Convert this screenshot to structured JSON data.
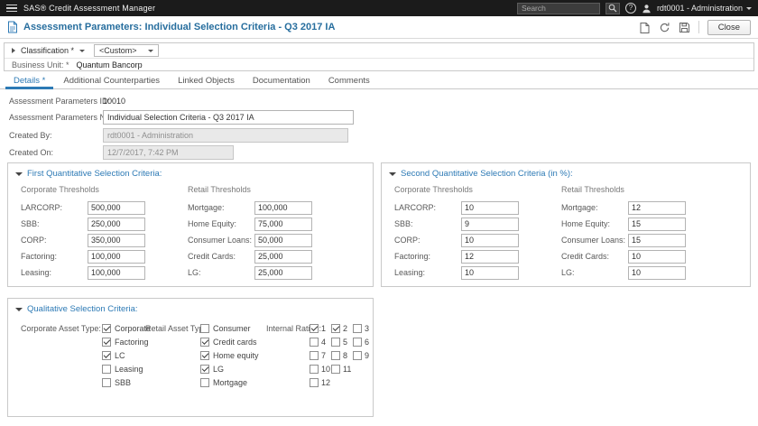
{
  "topbar": {
    "app_title": "SAS® Credit Assessment Manager",
    "search_placeholder": "Search",
    "user_label": "rdt0001 - Administration"
  },
  "header": {
    "title": "Assessment Parameters: Individual Selection Criteria - Q3 2017 IA",
    "close_label": "Close"
  },
  "toolbar": {
    "classification_label": "Classification *",
    "classification_value": "<Custom>",
    "business_unit_label": "Business Unit: *",
    "business_unit_value": "Quantum Bancorp"
  },
  "tabs": [
    {
      "label": "Details *"
    },
    {
      "label": "Additional Counterparties"
    },
    {
      "label": "Linked Objects"
    },
    {
      "label": "Documentation"
    },
    {
      "label": "Comments"
    }
  ],
  "form": {
    "rows": [
      {
        "label": "Assessment Parameters ID:",
        "value": "10010"
      },
      {
        "label": "Assessment Parameters Name: *",
        "value": "Individual Selection Criteria - Q3 2017 IA"
      },
      {
        "label": "Created By:",
        "value": "rdt0001 - Administration"
      },
      {
        "label": "Created On:",
        "value": "12/7/2017, 7:42 PM"
      }
    ]
  },
  "first_criteria": {
    "title": "First Quantitative Selection Criteria:",
    "corporate_header": "Corporate Thresholds",
    "retail_header": "Retail Thresholds",
    "corporate": [
      {
        "label": "LARCORP:",
        "value": "500,000"
      },
      {
        "label": "SBB:",
        "value": "250,000"
      },
      {
        "label": "CORP:",
        "value": "350,000"
      },
      {
        "label": "Factoring:",
        "value": "100,000"
      },
      {
        "label": "Leasing:",
        "value": "100,000"
      }
    ],
    "retail": [
      {
        "label": "Mortgage:",
        "value": "100,000"
      },
      {
        "label": "Home Equity:",
        "value": "75,000"
      },
      {
        "label": "Consumer Loans:",
        "value": "50,000"
      },
      {
        "label": "Credit Cards:",
        "value": "25,000"
      },
      {
        "label": "LG:",
        "value": "25,000"
      }
    ]
  },
  "second_criteria": {
    "title": "Second Quantitative Selection Criteria (in %):",
    "corporate_header": "Corporate Thresholds",
    "retail_header": "Retail Thresholds",
    "corporate": [
      {
        "label": "LARCORP:",
        "value": "10"
      },
      {
        "label": "SBB:",
        "value": "9"
      },
      {
        "label": "CORP:",
        "value": "10"
      },
      {
        "label": "Factoring:",
        "value": "12"
      },
      {
        "label": "Leasing:",
        "value": "10"
      }
    ],
    "retail": [
      {
        "label": "Mortgage:",
        "value": "12"
      },
      {
        "label": "Home Equity:",
        "value": "15"
      },
      {
        "label": "Consumer Loans:",
        "value": "15"
      },
      {
        "label": "Credit Cards:",
        "value": "10"
      },
      {
        "label": "LG:",
        "value": "10"
      }
    ]
  },
  "qualitative": {
    "title": "Qualitative Selection Criteria:",
    "corporate_label": "Corporate Asset Type:",
    "corporate_options": [
      {
        "label": "Corporate",
        "checked": true
      },
      {
        "label": "Factoring",
        "checked": true
      },
      {
        "label": "LC",
        "checked": true
      },
      {
        "label": "Leasing",
        "checked": false
      },
      {
        "label": "SBB",
        "checked": false
      }
    ],
    "retail_label": "Retail Asset Type:",
    "retail_options": [
      {
        "label": "Consumer",
        "checked": false
      },
      {
        "label": "Credit cards",
        "checked": true
      },
      {
        "label": "Home equity",
        "checked": true
      },
      {
        "label": "LG",
        "checked": true
      },
      {
        "label": "Mortgage",
        "checked": false
      }
    ],
    "rating_label": "Internal Rating:",
    "rating_options": [
      {
        "label": "1",
        "checked": true
      },
      {
        "label": "2",
        "checked": true
      },
      {
        "label": "3",
        "checked": false
      },
      {
        "label": "4",
        "checked": false
      },
      {
        "label": "5",
        "checked": false
      },
      {
        "label": "6",
        "checked": false
      },
      {
        "label": "7",
        "checked": false
      },
      {
        "label": "8",
        "checked": false
      },
      {
        "label": "9",
        "checked": false
      },
      {
        "label": "10",
        "checked": false
      },
      {
        "label": "11",
        "checked": false
      },
      {
        "label": "12",
        "checked": false
      }
    ]
  }
}
